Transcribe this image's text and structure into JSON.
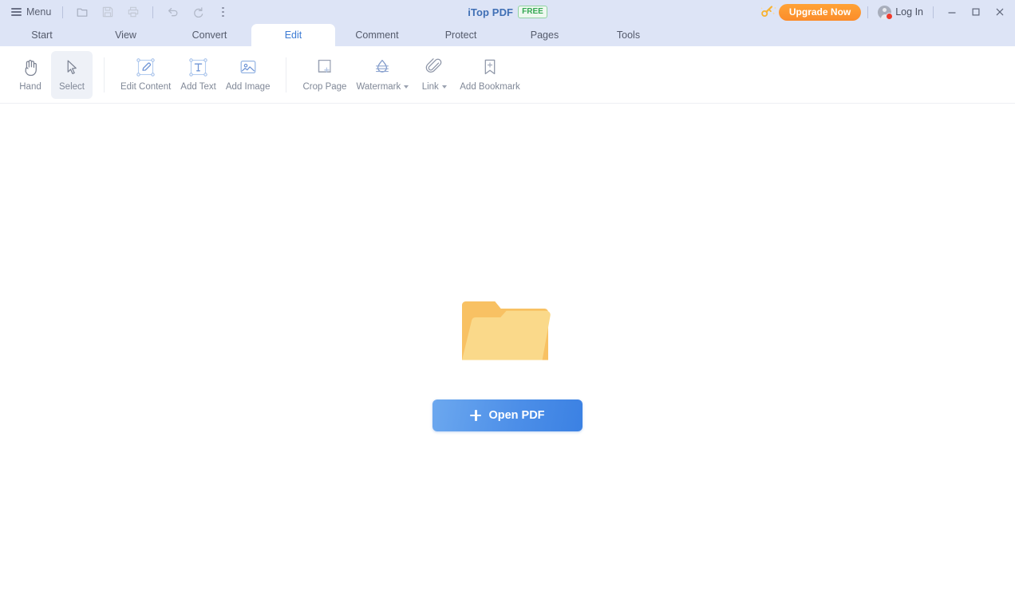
{
  "titlebar": {
    "menu_label": "Menu",
    "quick_actions": [
      {
        "name": "open-file-icon",
        "title": "Open"
      },
      {
        "name": "save-icon",
        "title": "Save"
      },
      {
        "name": "print-icon",
        "title": "Print"
      },
      {
        "name": "undo-icon",
        "title": "Undo"
      },
      {
        "name": "redo-icon",
        "title": "Redo"
      },
      {
        "name": "more-options-icon",
        "title": "More"
      }
    ],
    "app_name": "iTop PDF",
    "edition_badge": "FREE",
    "upgrade_label": "Upgrade Now",
    "login_label": "Log In",
    "window_controls": [
      "minimize",
      "maximize",
      "close"
    ]
  },
  "tabs": [
    {
      "label": "Start",
      "active": false
    },
    {
      "label": "View",
      "active": false
    },
    {
      "label": "Convert",
      "active": false
    },
    {
      "label": "Edit",
      "active": true
    },
    {
      "label": "Comment",
      "active": false
    },
    {
      "label": "Protect",
      "active": false
    },
    {
      "label": "Pages",
      "active": false
    },
    {
      "label": "Tools",
      "active": false
    }
  ],
  "toolbar": {
    "items": [
      {
        "label": "Hand",
        "icon": "hand-icon",
        "selected": false,
        "caret": false
      },
      {
        "label": "Select",
        "icon": "cursor-select-icon",
        "selected": true,
        "caret": false
      },
      {
        "label": "Edit Content",
        "icon": "edit-content-icon",
        "selected": false,
        "caret": false
      },
      {
        "label": "Add Text",
        "icon": "add-text-icon",
        "selected": false,
        "caret": false
      },
      {
        "label": "Add Image",
        "icon": "add-image-icon",
        "selected": false,
        "caret": false
      },
      {
        "label": "Crop Page",
        "icon": "crop-page-icon",
        "selected": false,
        "caret": false
      },
      {
        "label": "Watermark",
        "icon": "watermark-icon",
        "selected": false,
        "caret": true
      },
      {
        "label": "Link",
        "icon": "link-icon",
        "selected": false,
        "caret": true
      },
      {
        "label": "Add Bookmark",
        "icon": "add-bookmark-icon",
        "selected": false,
        "caret": false
      }
    ]
  },
  "canvas": {
    "placeholder_icon": "open-folder-illustration",
    "open_button_label": "Open PDF"
  },
  "colors": {
    "titlebar_bg": "#dde4f6",
    "tab_active_text": "#3c7bd4",
    "accent_blue": "#4d8fe8",
    "upgrade_orange": "#fb8c2a",
    "badge_green": "#34a853",
    "folder_back": "#f8c163",
    "folder_front": "#fad98a",
    "notification_red": "#ef3b2c"
  }
}
